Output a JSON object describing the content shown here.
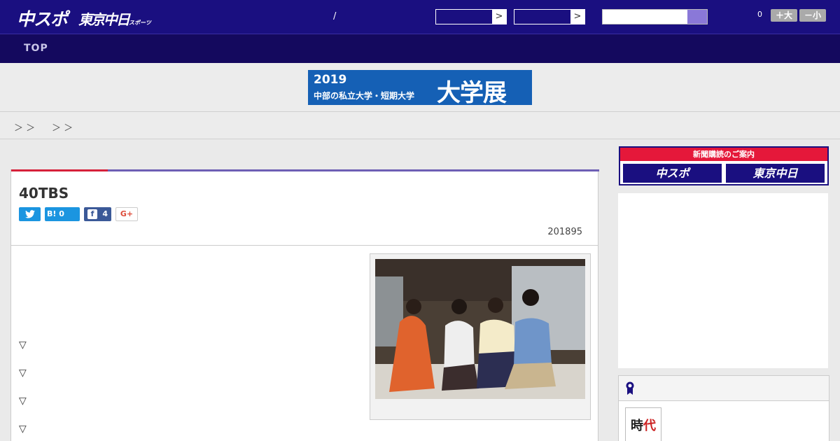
{
  "header": {
    "logo_main": "中スポ",
    "logo_sub": "東京中日",
    "logo_sub_small": "スポーツ",
    "slash": "/",
    "select_arrow_1": ">",
    "select_arrow_2": ">",
    "counter": "0",
    "font_larger_label": "＋大",
    "font_smaller_label": "－小"
  },
  "nav": {
    "top_label": "TOP"
  },
  "banner": {
    "year": "2019",
    "subtitle": "中部の私立大学・短期大学",
    "headline": "大学展"
  },
  "breadcrumb": {
    "sep1": "＞ ＞",
    "sep2": "＞ ＞"
  },
  "article": {
    "title": "40TBS",
    "share": {
      "twitter_icon": "twitter-bird",
      "hatena_label": "B!",
      "hatena_count": "0",
      "facebook_label": "f",
      "facebook_count": "4",
      "googleplus_label": "G+"
    },
    "date": "201895",
    "bullets": [
      "▽",
      "▽",
      "▽",
      "▽"
    ]
  },
  "sidebar": {
    "subscription_title": "新聞購読のご案内",
    "subscription_chuspo": "中スポ",
    "subscription_tokyo": "東京中日",
    "ranking_icon": "ribbon-icon",
    "thumb_text_1": "時",
    "thumb_text_2": "代"
  },
  "colors": {
    "header_bg": "#1a0f80",
    "nav_bg": "#14095e",
    "accent_red": "#d6213a",
    "accent_purple": "#6d5fb4",
    "banner_bg": "#1560b5"
  }
}
